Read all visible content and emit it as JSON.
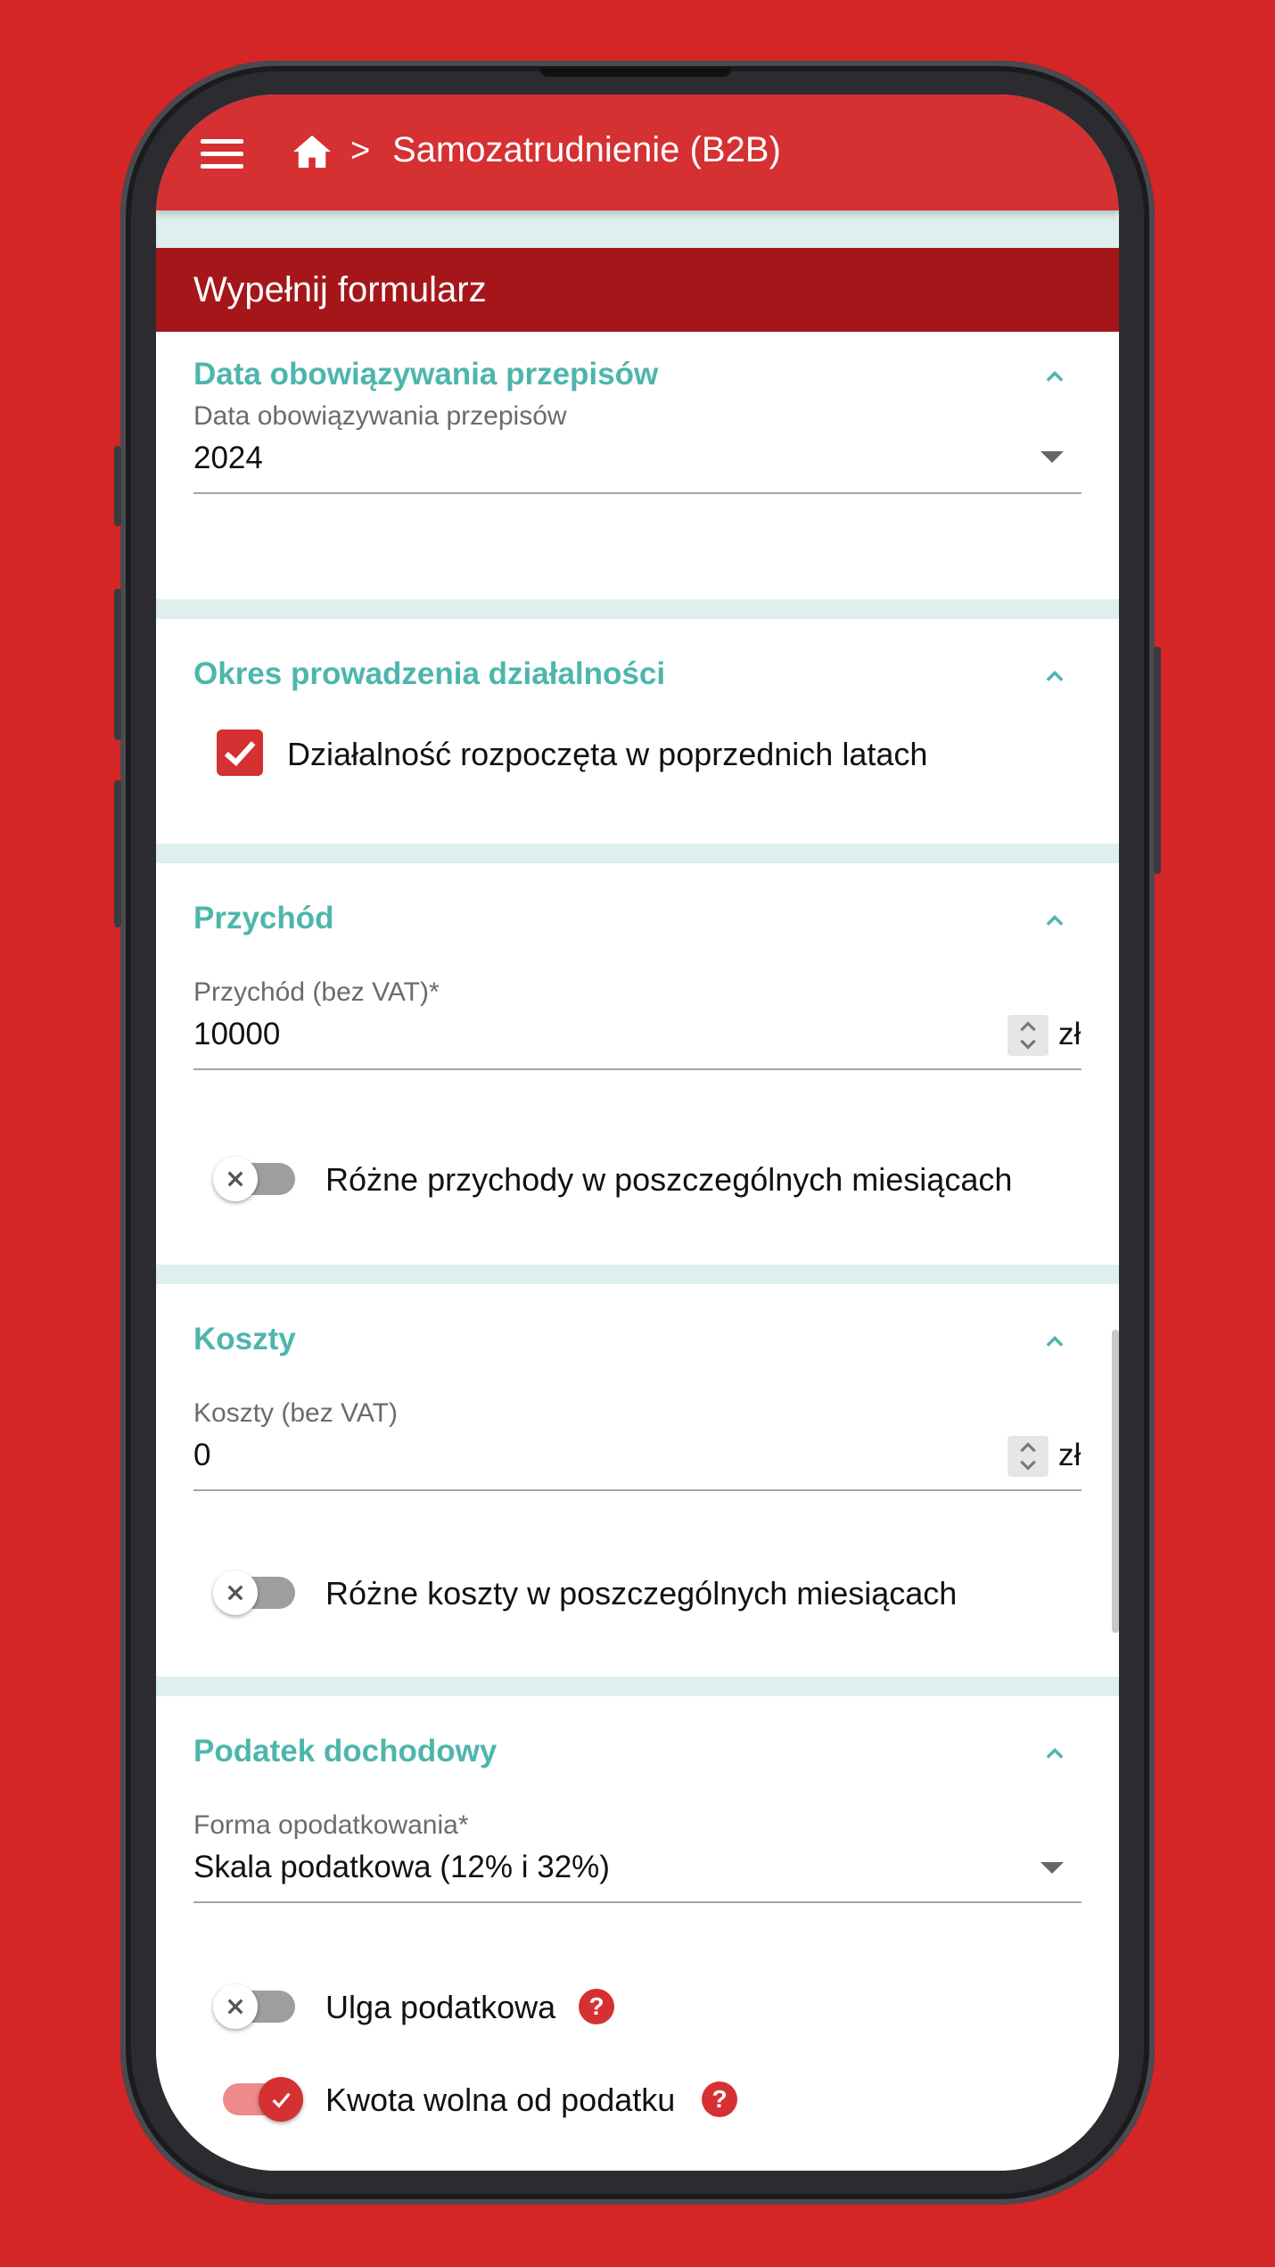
{
  "app_bar": {
    "title": "Samozatrudnienie (B2B)",
    "separator": ">",
    "menu_icon": "hamburger-menu-icon",
    "home_icon": "home-icon",
    "color": "#d53032"
  },
  "form_header": {
    "title": "Wypełnij formularz",
    "color": "#a4161a"
  },
  "sections": {
    "data": {
      "title": "Data obowiązywania przepisów",
      "field_label": "Data obowiązywania przepisów",
      "field_value": "2024"
    },
    "okres": {
      "title": "Okres prowadzenia działalności",
      "checkbox_label": "Działalność rozpoczęta w poprzednich latach",
      "checked": true
    },
    "przychod": {
      "title": "Przychód",
      "field_label": "Przychód (bez VAT)*",
      "field_value": "10000",
      "unit": "zł",
      "toggle_label": "Różne przychody w poszczególnych miesiącach",
      "toggle_on": false
    },
    "koszty": {
      "title": "Koszty",
      "field_label": "Koszty (bez VAT)",
      "field_value": "0",
      "unit": "zł",
      "toggle_label": "Różne koszty w poszczególnych miesiącach",
      "toggle_on": false
    },
    "podatek": {
      "title": "Podatek dochodowy",
      "field_label": "Forma opodatkowania*",
      "field_value": "Skala podatkowa (12% i 32%)",
      "toggle1_label": "Ulga podatkowa",
      "toggle1_on": false,
      "toggle2_label": "Kwota wolna od podatku",
      "toggle2_on": true,
      "help_glyph": "?"
    }
  },
  "colors": {
    "accent_teal": "#4db6ac",
    "background": "#d42626"
  }
}
